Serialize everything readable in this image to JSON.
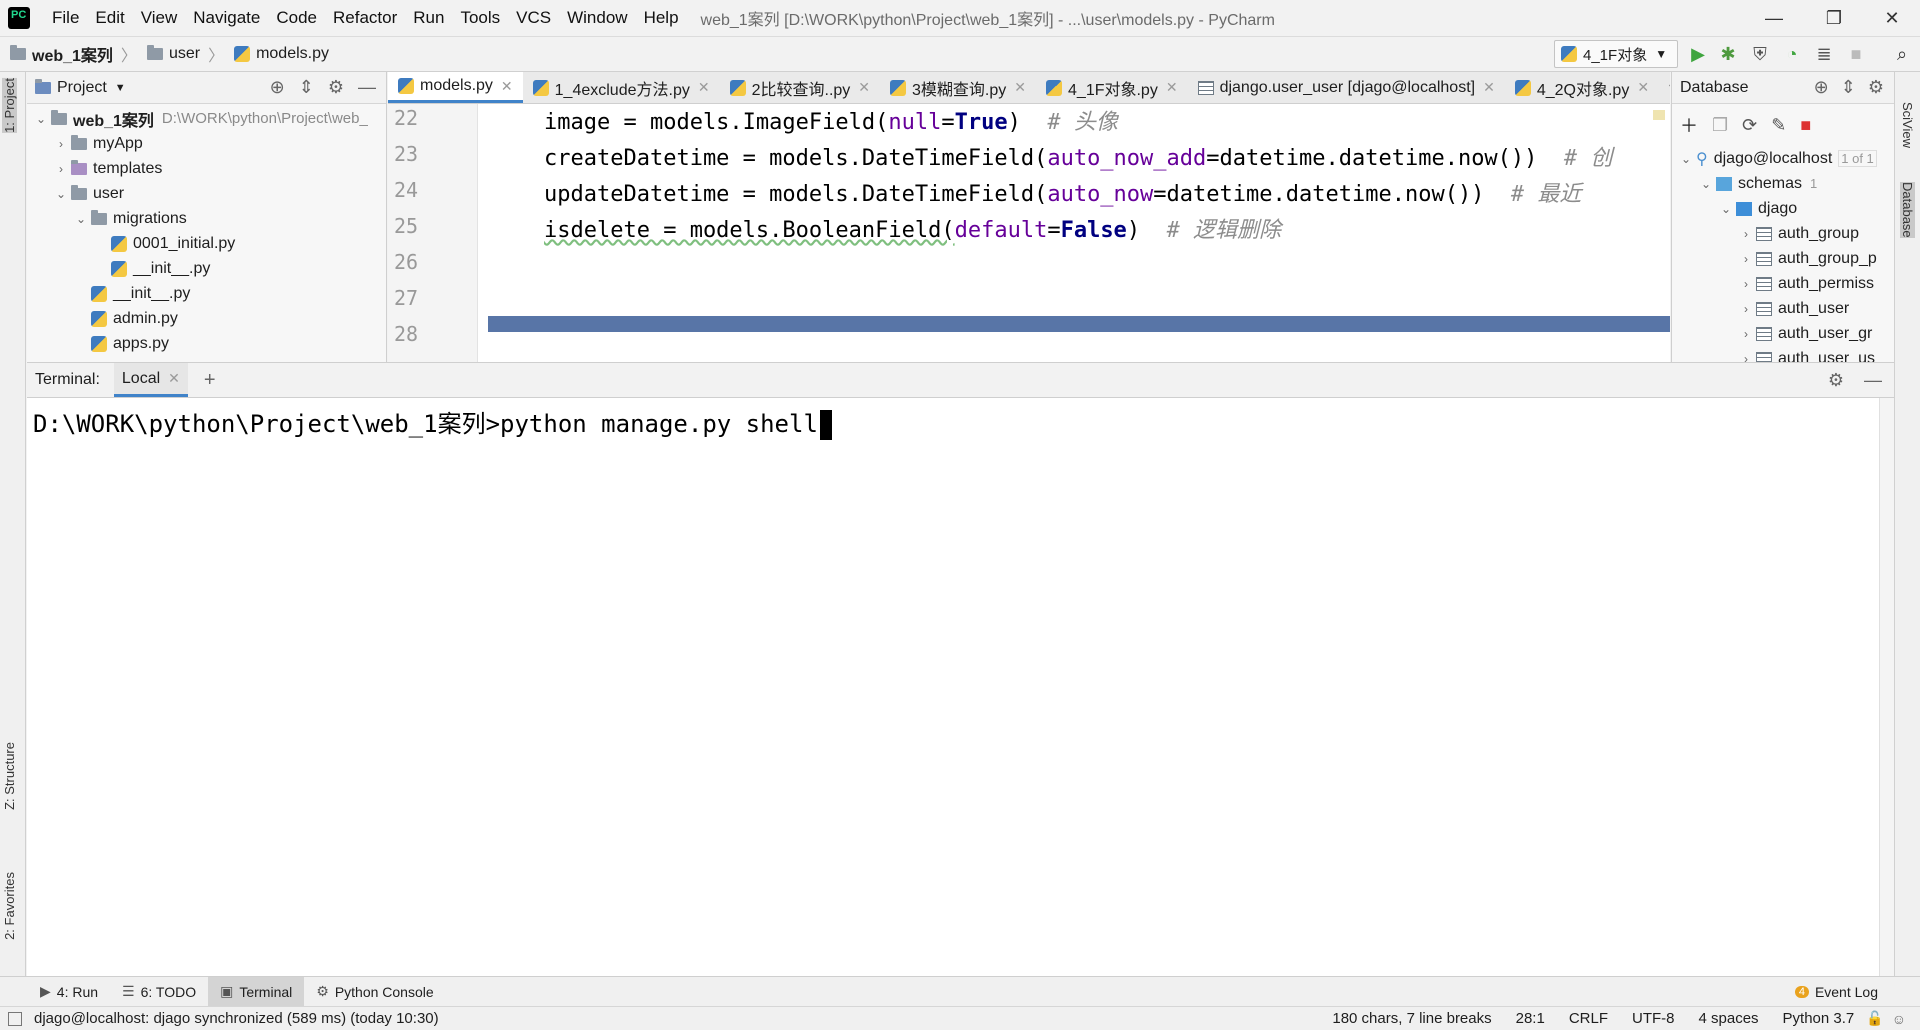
{
  "menu": {
    "items": [
      "File",
      "Edit",
      "View",
      "Navigate",
      "Code",
      "Refactor",
      "Run",
      "Tools",
      "VCS",
      "Window",
      "Help"
    ],
    "window_title": "web_1案列 [D:\\WORK\\python\\Project\\web_1案列] - ...\\user\\models.py - PyCharm"
  },
  "window_controls": {
    "minimize": "—",
    "restore": "❐",
    "close": "✕"
  },
  "breadcrumb": {
    "project": "web_1案列",
    "folder": "user",
    "file": "models.py"
  },
  "run_config": {
    "label": "4_1F对象"
  },
  "project_panel": {
    "title": "Project",
    "root": {
      "name": "web_1案列",
      "path": "D:\\WORK\\python\\Project\\web_"
    },
    "items": [
      {
        "label": "myApp"
      },
      {
        "label": "templates"
      },
      {
        "label": "user"
      },
      {
        "label": "migrations"
      },
      {
        "label": "0001_initial.py"
      },
      {
        "label": "__init__.py"
      },
      {
        "label": "__init__.py"
      },
      {
        "label": "admin.py"
      },
      {
        "label": "apps.py"
      }
    ]
  },
  "editor": {
    "tabs": [
      {
        "label": "models.py",
        "active": true
      },
      {
        "label": "1_4exclude方法.py"
      },
      {
        "label": "2比较查询..py"
      },
      {
        "label": "3模糊查询.py"
      },
      {
        "label": "4_1F对象.py"
      },
      {
        "label": "django.user_user [djago@localhost]"
      },
      {
        "label": "4_2Q对象.py"
      }
    ],
    "tab_overflow": "▾≡",
    "line_numbers": [
      "22",
      "23",
      "24",
      "25",
      "26",
      "27",
      "28"
    ],
    "lines": [
      {
        "pre": "image = models.ImageField(",
        "arg": "null",
        "eq": "=",
        "kwv": "True",
        "post": ")  ",
        "comment": "# 头像"
      },
      {
        "pre": "createDatetime = models.DateTimeField(",
        "arg": "auto_now_add",
        "eq": "=",
        "kwv": "",
        "post": "datetime.datetime.now())  ",
        "comment": "# 创"
      },
      {
        "pre": "updateDatetime = models.DateTimeField(",
        "arg": "auto_now",
        "eq": "=",
        "kwv": "",
        "post": "datetime.datetime.now())  ",
        "comment": "# 最近"
      },
      {
        "pre": "isdelete = models.BooleanField(",
        "arg": "default",
        "eq": "=",
        "kwv": "False",
        "post": ")  ",
        "comment": "# 逻辑删除"
      }
    ]
  },
  "database_panel": {
    "title": "Database",
    "connection": "djago@localhost",
    "connection_badge": "1 of 1",
    "schemas": "schemas",
    "schemas_count": "1",
    "schema": "djago",
    "tables": [
      "auth_group",
      "auth_group_p",
      "auth_permiss",
      "auth_user",
      "auth_user_gr",
      "auth_user_us"
    ]
  },
  "terminal": {
    "label": "Terminal:",
    "tab": "Local",
    "add": "+",
    "line": "D:\\WORK\\python\\Project\\web_1案列>python manage.py shell"
  },
  "side_tabs": {
    "project": "1: Project",
    "structure": "Z: Structure",
    "favorites": "2: Favorites",
    "sciview": "SciView",
    "database": "Database"
  },
  "tool_bar": {
    "run": "4: Run",
    "todo": "6: TODO",
    "terminal": "Terminal",
    "python_console": "Python Console",
    "event_log": "Event Log",
    "event_count": "4"
  },
  "status": {
    "message": "djago@localhost: djago synchronized (589 ms) (today 10:30)",
    "chars": "180 chars, 7 line breaks",
    "position": "28:1",
    "line_sep": "CRLF",
    "encoding": "UTF-8",
    "indent": "4 spaces",
    "interpreter": "Python 3.7"
  }
}
